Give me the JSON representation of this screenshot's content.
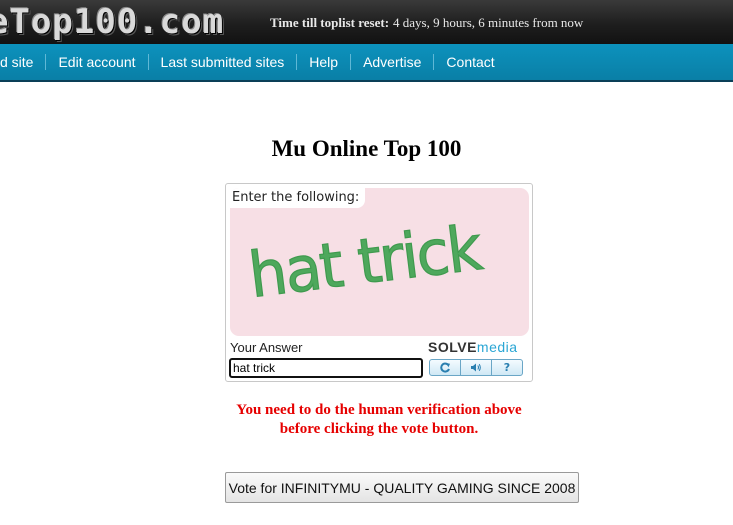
{
  "header": {
    "logo_text": "eTop100.com",
    "timer_label": "Time till toplist reset:",
    "timer_value": "4 days, 9 hours, 6 minutes from now"
  },
  "nav": {
    "items": [
      {
        "label": "d site"
      },
      {
        "label": "Edit account"
      },
      {
        "label": "Last submitted sites"
      },
      {
        "label": "Help"
      },
      {
        "label": "Advertise"
      },
      {
        "label": "Contact"
      }
    ]
  },
  "main": {
    "title": "Mu Online Top 100",
    "warning_line1": "You need to do the human verification above",
    "warning_line2": "before clicking the vote button.",
    "vote_button_label": "Vote for INFINITYMU - QUALITY GAMING SINCE 2008"
  },
  "captcha": {
    "prompt": "Enter the following:",
    "challenge_text": "hat trick",
    "answer_label": "Your Answer",
    "answer_value": "hat trick",
    "brand_bold": "SOLVE",
    "brand_light": "media",
    "buttons": {
      "refresh": "refresh-icon",
      "audio": "audio-icon",
      "help": "?"
    },
    "colors": {
      "text": "#4ea85c",
      "background": "#f7dfe5"
    }
  },
  "colors": {
    "nav": "#0a86b0",
    "warning": "#e60000"
  }
}
